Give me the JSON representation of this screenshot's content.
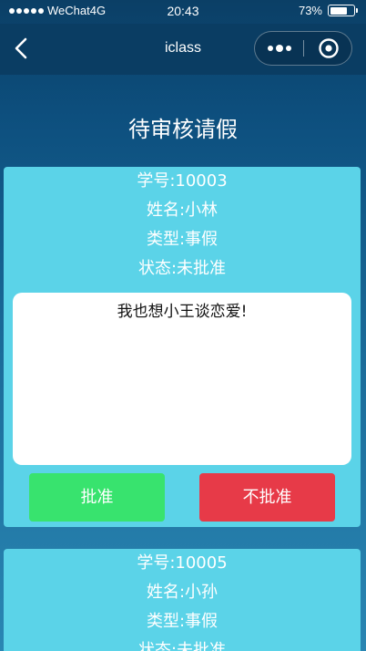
{
  "status_bar": {
    "carrier": "WeChat4G",
    "time": "20:43",
    "battery_percent": "73%",
    "battery_level": 0.73
  },
  "nav": {
    "title": "iclass"
  },
  "page": {
    "title": "待审核请假"
  },
  "requests": [
    {
      "student_id": "学号:10003",
      "name": "姓名:小林",
      "type": "类型:事假",
      "status": "状态:未批准",
      "reason": "我也想小王谈恋爱!",
      "approve_label": "批准",
      "reject_label": "不批准"
    },
    {
      "student_id": "学号:10005",
      "name": "姓名:小孙",
      "type": "类型:事假",
      "status": "状态:未批准"
    }
  ],
  "colors": {
    "card": "#5bd3e8",
    "approve": "#38e36e",
    "reject": "#e73a48"
  }
}
